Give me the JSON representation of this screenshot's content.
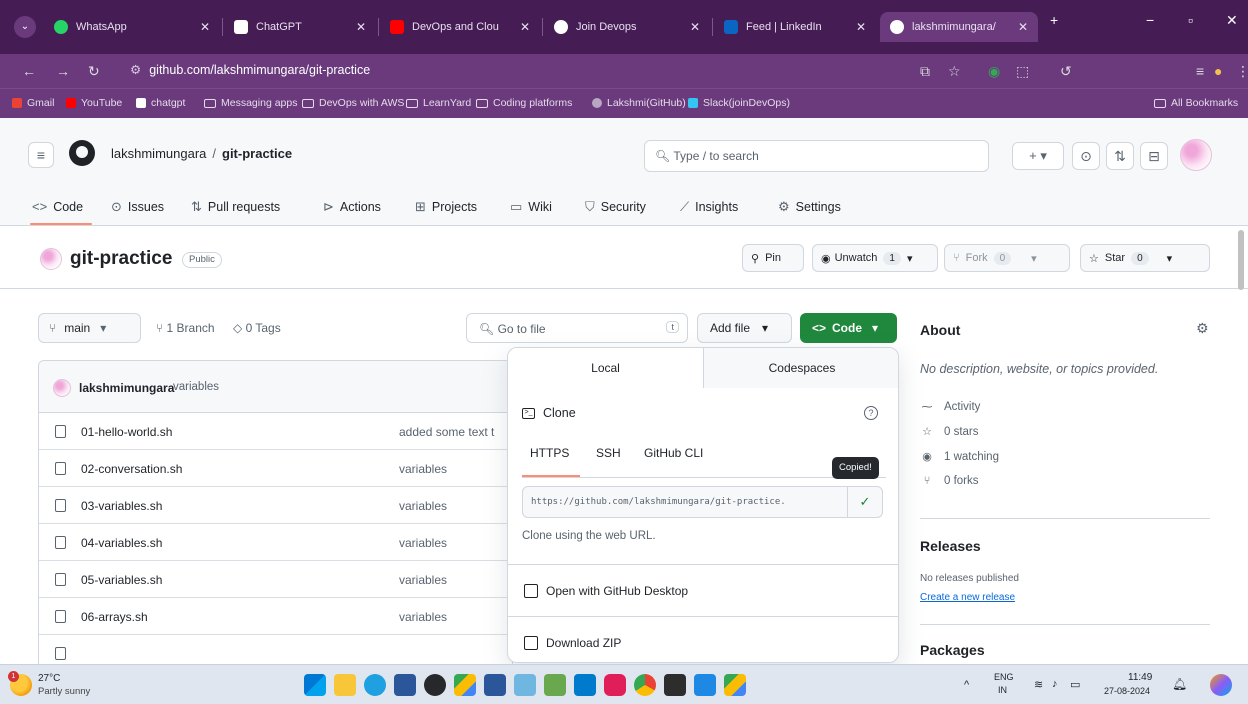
{
  "browser": {
    "tabs": [
      {
        "title": "WhatsApp",
        "color": "#25d366"
      },
      {
        "title": "ChatGPT",
        "color": "#ffffff"
      },
      {
        "title": "DevOps and Clou",
        "color": "#ff0000"
      },
      {
        "title": "Join Devops",
        "color": "#ffffff"
      },
      {
        "title": "Feed | LinkedIn",
        "color": "#0a66c2"
      },
      {
        "title": "lakshmimungara/",
        "color": "#ffffff"
      }
    ],
    "url": "github.com/lakshmimungara/git-practice",
    "bookmarks": [
      {
        "label": "Gmail",
        "type": "site",
        "color": "#ea4335"
      },
      {
        "label": "YouTube",
        "type": "site",
        "color": "#ff0000"
      },
      {
        "label": "chatgpt",
        "type": "site",
        "color": "#ffffff"
      },
      {
        "label": "Messaging apps",
        "type": "folder"
      },
      {
        "label": "DevOps with AWS",
        "type": "folder"
      },
      {
        "label": "LearnYard",
        "type": "folder"
      },
      {
        "label": "Coding platforms",
        "type": "folder"
      },
      {
        "label": "Lakshmi(GitHub)",
        "type": "site",
        "color": "#b8a6c2"
      },
      {
        "label": "Slack(joinDevOps)",
        "type": "site",
        "color": "#36c5f0"
      }
    ],
    "all_bookmarks": "All Bookmarks"
  },
  "github": {
    "owner": "lakshmimungara",
    "repo": "git-practice",
    "search_text": "Type / to search",
    "nav": [
      "Code",
      "Issues",
      "Pull requests",
      "Actions",
      "Projects",
      "Wiki",
      "Security",
      "Insights",
      "Settings"
    ],
    "visibility": "Public",
    "pin": "Pin",
    "unwatch": "Unwatch",
    "unwatch_count": "1",
    "fork": "Fork",
    "fork_count": "0",
    "star": "Star",
    "star_count": "0",
    "branch": "main",
    "branches": "1 Branch",
    "tags": "0 Tags",
    "goto_file": "Go to file",
    "goto_key": "t",
    "add_file": "Add file",
    "code": "Code"
  },
  "files": {
    "commit_user": "lakshmimungara",
    "commit_msg": "variables",
    "rows": [
      {
        "name": "01-hello-world.sh",
        "msg": "added some text t"
      },
      {
        "name": "02-conversation.sh",
        "msg": "variables"
      },
      {
        "name": "03-variables.sh",
        "msg": "variables"
      },
      {
        "name": "04-variables.sh",
        "msg": "variables"
      },
      {
        "name": "05-variables.sh",
        "msg": "variables"
      },
      {
        "name": "06-arrays.sh",
        "msg": "variables"
      }
    ]
  },
  "clone": {
    "tab_local": "Local",
    "tab_codespaces": "Codespaces",
    "heading": "Clone",
    "protocols": [
      "HTTPS",
      "SSH",
      "GitHub CLI"
    ],
    "tooltip": "Copied!",
    "url": "https://github.com/lakshmimungara/git-practice.",
    "hint": "Clone using the web URL.",
    "open_desktop": "Open with GitHub Desktop",
    "download_zip": "Download ZIP"
  },
  "about": {
    "title": "About",
    "description": "No description, website, or topics provided.",
    "activity": "Activity",
    "stars": "0 stars",
    "watching": "1 watching",
    "forks": "0 forks",
    "releases_title": "Releases",
    "no_releases": "No releases published",
    "create_release": "Create a new release",
    "packages_title": "Packages"
  },
  "taskbar": {
    "temp": "27°C",
    "condition": "Partly sunny",
    "lang1": "ENG",
    "lang2": "IN",
    "time": "11:49",
    "date": "27-08-2024"
  }
}
